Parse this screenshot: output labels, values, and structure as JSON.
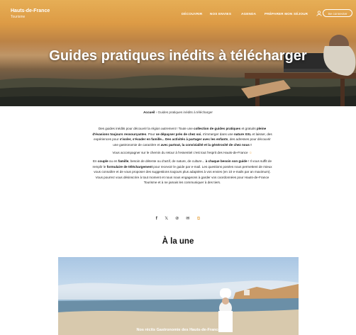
{
  "brand": {
    "name": "Hauts-de-France",
    "sub": "Tourisme"
  },
  "nav": {
    "items": [
      "DÉCOUVRIR",
      "NOS ENVIES",
      "AGENDA",
      "PRÉPARER MON SÉJOUR"
    ],
    "connect_label": "Se connecter"
  },
  "hero": {
    "title": "Guides pratiques inédits à télécharger"
  },
  "breadcrumb": {
    "home": "Accueil",
    "separator": "›",
    "current": "Guides pratiques inédits à télécharger"
  },
  "intro": {
    "p1": {
      "a": "Des guides inédits pour découvrir la région autrement ! Toute une ",
      "b": "collection de guides pratiques",
      "c": " et gratuits ",
      "d": "pleine d'évasions toujours ressourçantes",
      "e": ". Pour ",
      "f": "se dépayser près de chez soi",
      "g": ", s'immerger dans une ",
      "h": "nature XXL",
      "i": " et laisser, des expériences pour ",
      "j": "s'isoler, s'évader en famille...",
      "k": " Des activités à partager avec les enfants",
      "l": ", des adresses pour découvrir une gastronomie de caractère et ",
      "m": "avec partout, la convivialité et la générosité de chez nous !"
    },
    "p2": "Vous accompagner sur le chemin du retour à l'essentiel c'est tout l'esprit des Hauts-de-France",
    "p3": {
      "a": "En ",
      "b": "couple",
      "c": " ou en ",
      "d": "famille",
      "e": ", besoin de détente ou d'actif, de nature, de culture... ",
      "f": "à chaque besoin son guide",
      "g": " ! Il vous suffit de remplir le ",
      "h": "formulaire de téléchargement",
      "i": " pour recevoir le guide par e-mail. Les questions posées nous permettent de mieux vous connaître et de vous proposer des suggestions toujours plus adaptées à vos envies (en 10 e-mails par an maximum). Vous pourrez vous désinscrire à tout moment et nous nous engageons à garder vos coordonnées pour Hauts-de-France Tourisme et à ne jamais les communiquer à des tiers."
    }
  },
  "share": {
    "icons": [
      "facebook-icon",
      "x-icon",
      "pinterest-icon",
      "email-icon",
      "copy-link-icon"
    ]
  },
  "section": {
    "title": "À la une"
  },
  "feature": {
    "caption": "Nos récits Gastronomie des Hauts-de-France"
  },
  "colors": {
    "accent": "#e8a84a",
    "text": "#1b1b1b"
  }
}
